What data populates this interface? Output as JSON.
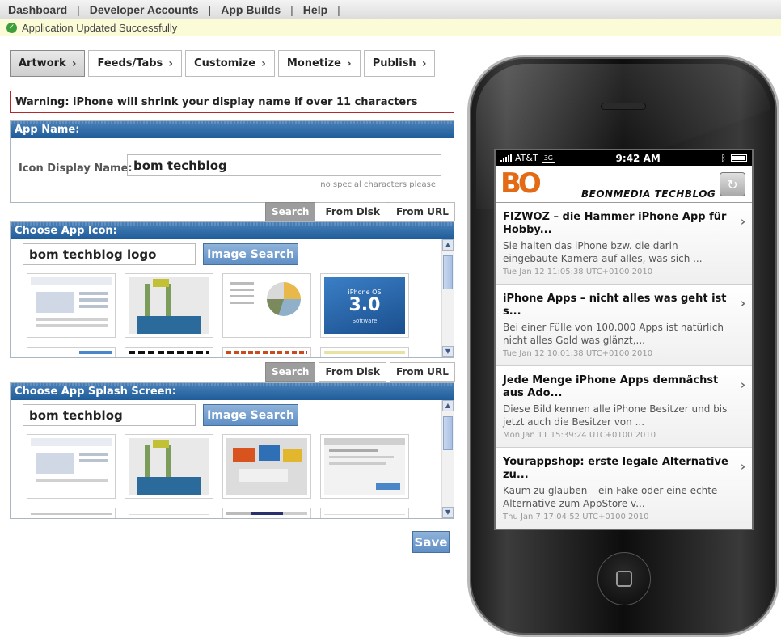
{
  "nav": {
    "items": [
      "Dashboard",
      "Developer Accounts",
      "App Builds",
      "Help"
    ],
    "separator": "|"
  },
  "status": {
    "message": "Application Updated Successfully",
    "icon": "check-circle-icon",
    "color": "#3c9e3c"
  },
  "tabs": [
    {
      "label": "Artwork",
      "active": true
    },
    {
      "label": "Feeds/Tabs"
    },
    {
      "label": "Customize"
    },
    {
      "label": "Monetize"
    },
    {
      "label": "Publish"
    }
  ],
  "warning": "Warning: iPhone will shrink your display name if over 11 characters",
  "app_name": {
    "header": "App Name:",
    "label": "Icon Display Name:",
    "value": "bom techblog",
    "hint": "no special characters please"
  },
  "source_buttons": [
    "Search",
    "From Disk",
    "From URL"
  ],
  "icon_section": {
    "header": "Choose App Icon:",
    "query": "bom techblog logo",
    "search_button": "Image Search",
    "iphone_os_label": "iPhone OS",
    "iphone_os_version": "3.0",
    "iphone_os_sub": "Software"
  },
  "splash_section": {
    "header": "Choose App Splash Screen:",
    "query": "bom techblog",
    "search_button": "Image Search"
  },
  "save_label": "Save",
  "phone": {
    "carrier": "AT&T",
    "network": "3G",
    "time": "9:42 AM",
    "blog_logo": "BO",
    "blog_title": "BEONMEDIA TECHBLOG",
    "feed": [
      {
        "title": "FIZWOZ – die Hammer iPhone App für Hobby...",
        "desc": "Sie halten das iPhone bzw. die darin eingebaute Kamera auf alles, was sich ...",
        "date": "Tue Jan 12 11:05:38 UTC+0100 2010"
      },
      {
        "title": "iPhone Apps – nicht alles was geht ist s...",
        "desc": "Bei einer Fülle von 100.000 Apps ist natürlich nicht alles Gold was glänzt,...",
        "date": "Tue Jan 12 10:01:38 UTC+0100 2010"
      },
      {
        "title": "Jede Menge iPhone Apps demnächst aus Ado...",
        "desc": "Diese Bild kennen alle iPhone Besitzer und bis jetzt auch die Besitzer von ...",
        "date": "Mon Jan 11 15:39:24 UTC+0100 2010"
      },
      {
        "title": "Yourappshop: erste legale Alternative zu...",
        "desc": "Kaum zu glauben – ein Fake oder eine echte Alternative zum AppStore v...",
        "date": "Thu Jan 7 17:04:52 UTC+0100 2010"
      }
    ]
  }
}
